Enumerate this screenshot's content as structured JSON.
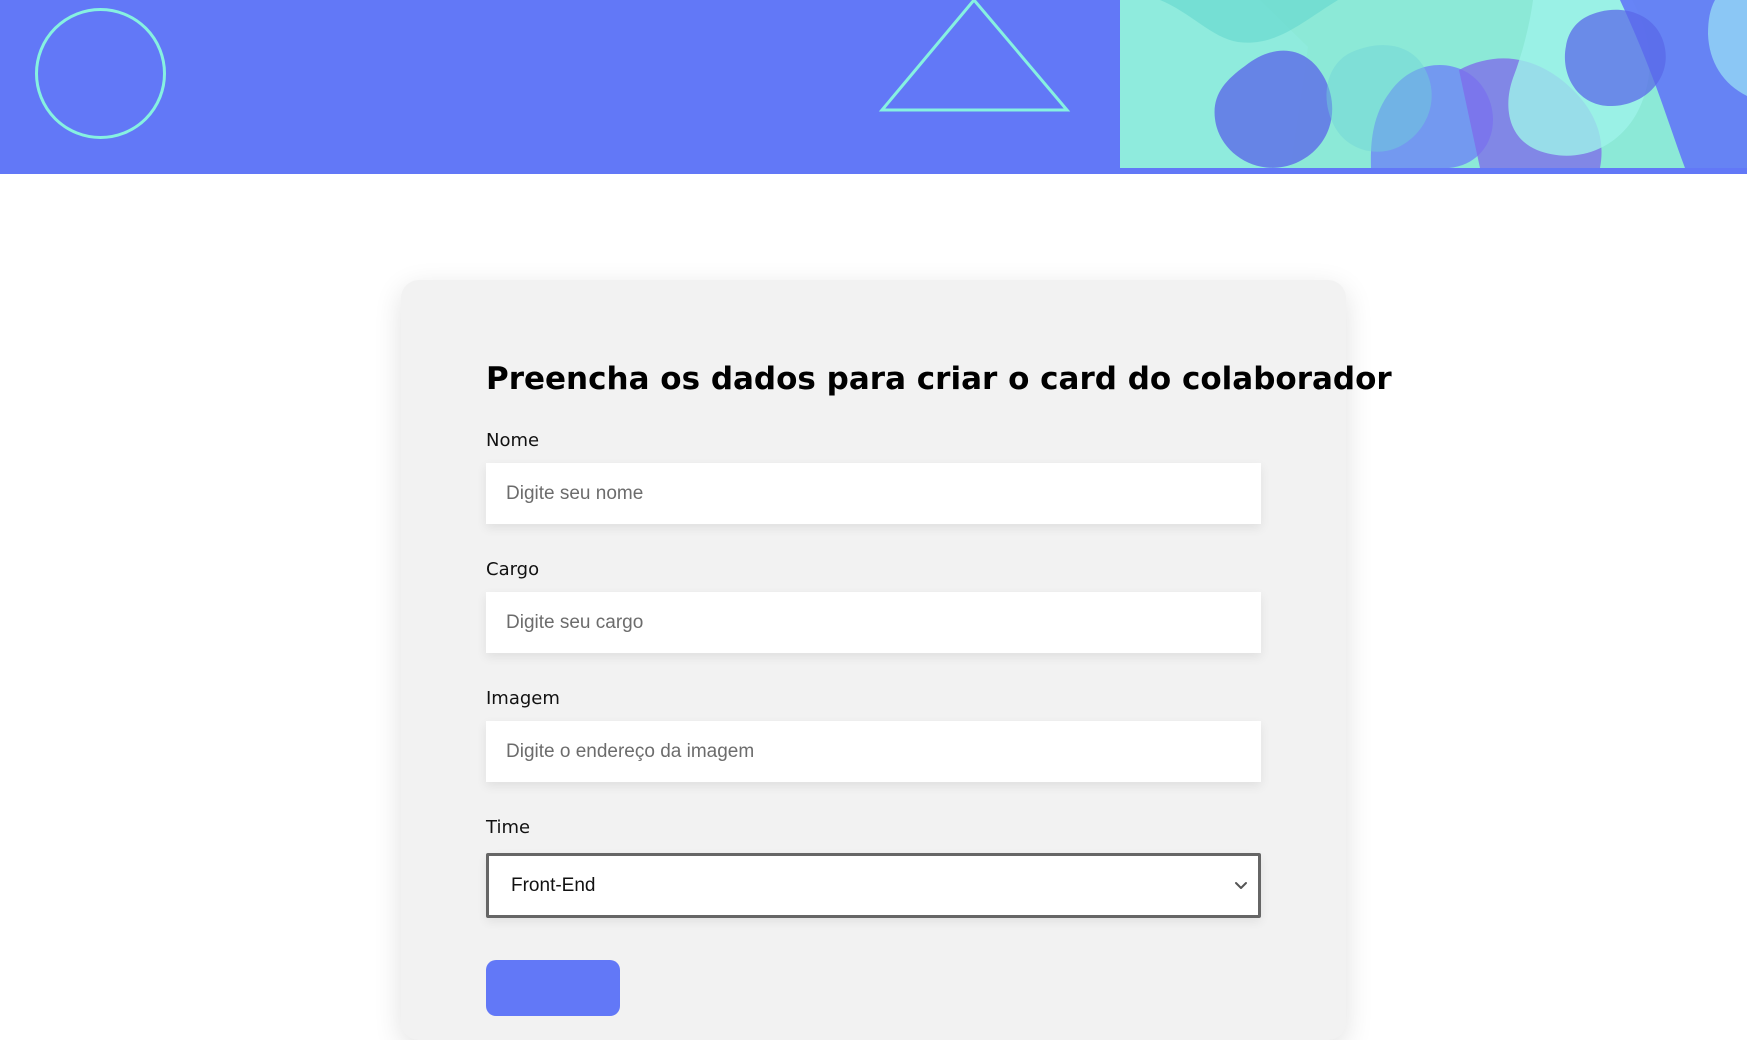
{
  "header": {
    "brand_color": "#6278F7",
    "accent_color": "#86F1E1",
    "photo_tint": "#8CE9D7"
  },
  "form": {
    "title": "Preencha os dados para criar o card do colaborador",
    "fields": [
      {
        "label": "Nome",
        "placeholder": "Digite seu nome",
        "value": ""
      },
      {
        "label": "Cargo",
        "placeholder": "Digite seu cargo",
        "value": ""
      },
      {
        "label": "Imagem",
        "placeholder": "Digite o endereço da imagem",
        "value": ""
      }
    ],
    "team": {
      "label": "Time",
      "selected": "Front-End"
    },
    "submit_label": ""
  },
  "icons": {
    "dropdown": "chevron-down-icon",
    "decorative_circle": "circle-outline-icon",
    "decorative_triangle": "triangle-outline-icon"
  }
}
